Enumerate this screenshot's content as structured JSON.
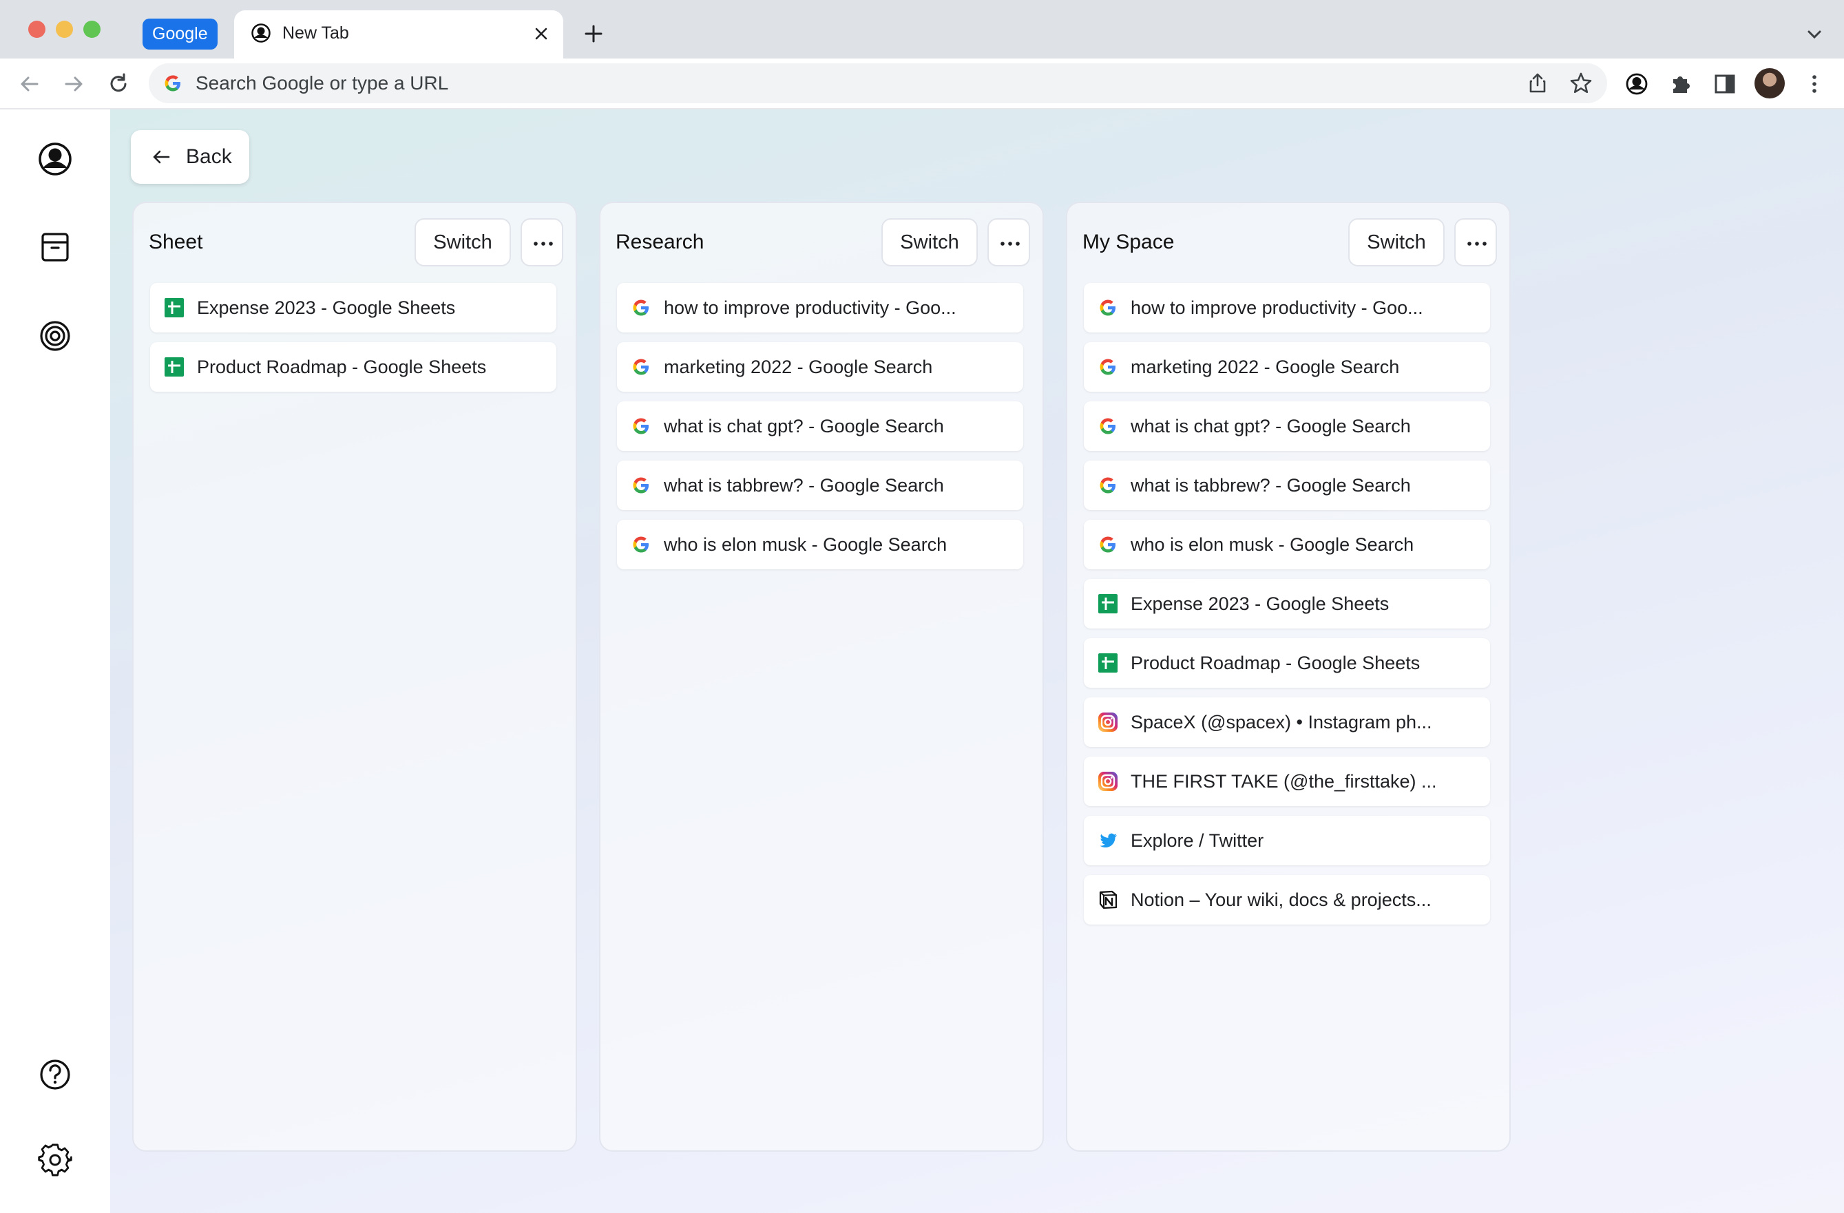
{
  "browser": {
    "tab_group_label": "Google",
    "active_tab_title": "New Tab",
    "omnibox_placeholder": "Search Google or type a URL"
  },
  "app": {
    "back_label": "Back",
    "columns": [
      {
        "title": "Sheet",
        "switch_label": "Switch",
        "items": [
          {
            "title": "Expense 2023 - Google Sheets",
            "icon": "google-sheets-icon"
          },
          {
            "title": "Product Roadmap - Google Sheets",
            "icon": "google-sheets-icon"
          }
        ]
      },
      {
        "title": "Research",
        "switch_label": "Switch",
        "items": [
          {
            "title": "how to improve productivity - Goo...",
            "icon": "google-icon"
          },
          {
            "title": "marketing 2022 - Google Search",
            "icon": "google-icon"
          },
          {
            "title": "what is chat gpt? - Google Search",
            "icon": "google-icon"
          },
          {
            "title": "what is tabbrew? - Google Search",
            "icon": "google-icon"
          },
          {
            "title": "who is elon musk - Google Search",
            "icon": "google-icon"
          }
        ]
      },
      {
        "title": "My Space",
        "switch_label": "Switch",
        "items": [
          {
            "title": "how to improve productivity - Goo...",
            "icon": "google-icon"
          },
          {
            "title": "marketing 2022 - Google Search",
            "icon": "google-icon"
          },
          {
            "title": "what is chat gpt? - Google Search",
            "icon": "google-icon"
          },
          {
            "title": "what is tabbrew? - Google Search",
            "icon": "google-icon"
          },
          {
            "title": "who is elon musk - Google Search",
            "icon": "google-icon"
          },
          {
            "title": "Expense 2023 - Google Sheets",
            "icon": "google-sheets-icon"
          },
          {
            "title": "Product Roadmap - Google Sheets",
            "icon": "google-sheets-icon"
          },
          {
            "title": "SpaceX (@spacex) • Instagram ph...",
            "icon": "instagram-icon"
          },
          {
            "title": "THE FIRST TAKE (@the_firsttake) ...",
            "icon": "instagram-icon"
          },
          {
            "title": "Explore / Twitter",
            "icon": "twitter-icon"
          },
          {
            "title": "Notion – Your wiki, docs & projects...",
            "icon": "notion-icon"
          }
        ]
      }
    ]
  },
  "colors": {
    "tab_group": "#1a73e8",
    "tabstrip": "#dee1e6",
    "sheets_green": "#0f9d58",
    "twitter_blue": "#1d9bf0"
  }
}
